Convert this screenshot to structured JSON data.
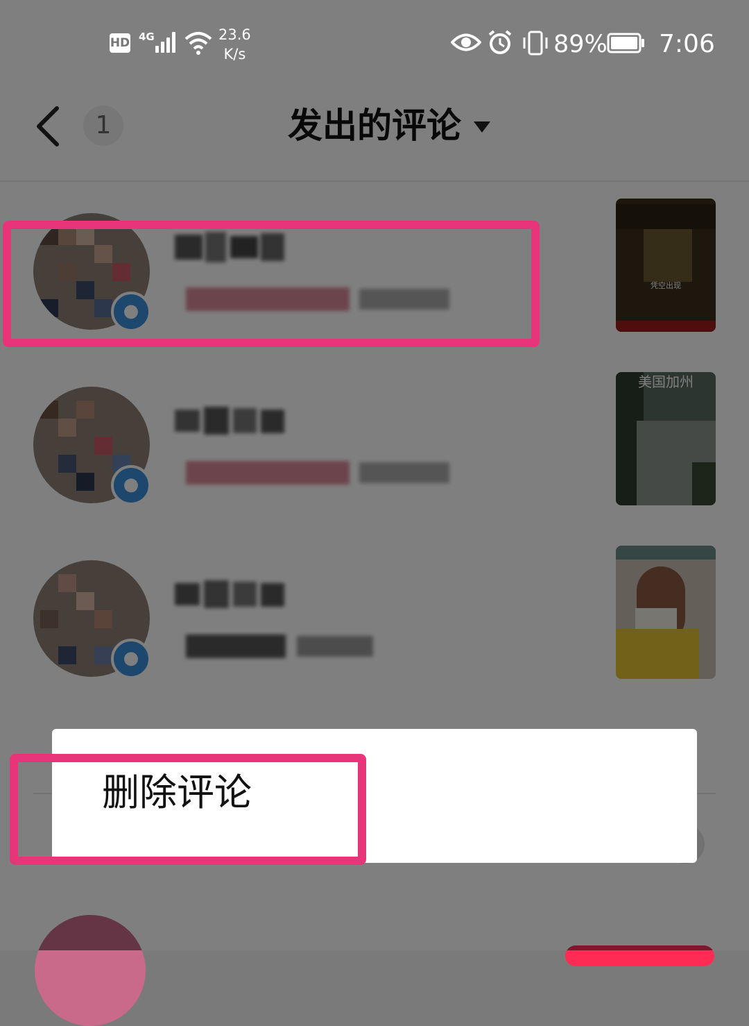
{
  "status_bar": {
    "hd": "HD",
    "network": "4G",
    "speed_line1": "23.6",
    "speed_line2": "K/s",
    "battery_percent": "89%",
    "time": "7:06"
  },
  "header": {
    "back_icon": "chevron-left-icon",
    "unread_count": "1",
    "title": "发出的评论",
    "title_icon": "caret-down-icon"
  },
  "rows": [
    {
      "thumbnail_caption": "凭空出现"
    },
    {
      "thumbnail_caption": "美国加州"
    },
    {
      "thumbnail_caption": ""
    }
  ],
  "context_menu": {
    "delete_label": "删除评论"
  },
  "colors": {
    "highlight": "#e8357a",
    "overlay": "rgba(0,0,0,0.5)",
    "accent_red": "#fe2c55"
  }
}
